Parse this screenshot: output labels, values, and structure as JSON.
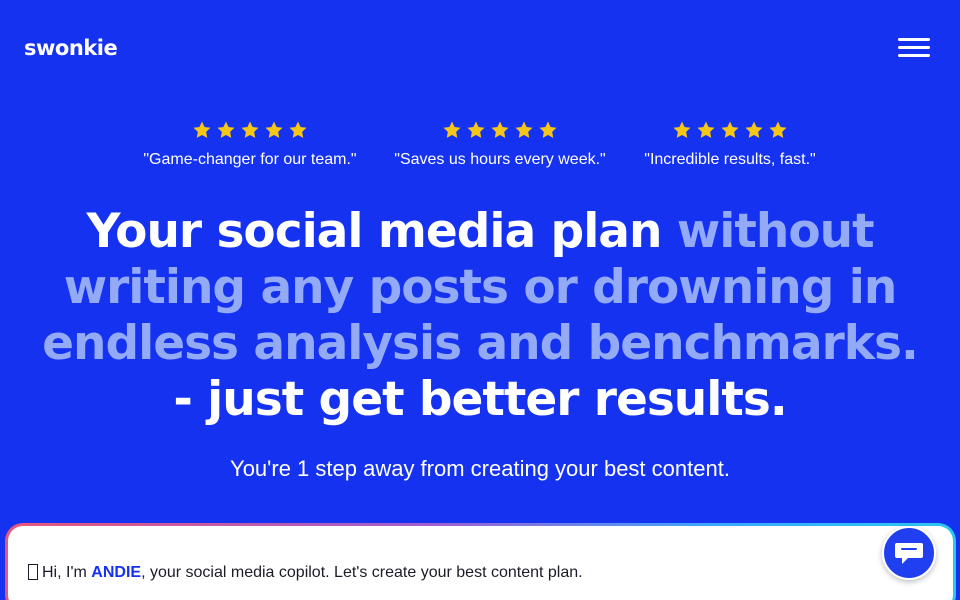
{
  "header": {
    "logo_text": "swonkie",
    "menu_icon": "hamburger-menu-icon"
  },
  "reviews": [
    {
      "rating": 5,
      "quote": "\"Game-changer for our team.\""
    },
    {
      "rating": 5,
      "quote": "\"Saves us hours every week.\""
    },
    {
      "rating": 5,
      "quote": "\"Incredible results, fast.\""
    }
  ],
  "hero": {
    "headline_part1": "Your social media plan ",
    "headline_part2": "without writing any posts or drowning in endless analysis and benchmarks.",
    "headline_part3": "- just get better results.",
    "subheadline": "You're 1 step away from creating your best content."
  },
  "chat": {
    "intro_prefix": "Hi, I'm ",
    "assistant_name": "ANDIE",
    "intro_suffix": ", your social media copilot. Let's create your best content plan.",
    "launcher_icon": "chat-bubble-icon"
  },
  "colors": {
    "background": "#1432f0",
    "headline_highlight": "#93aaf7",
    "star": "#f5c518",
    "accent": "#1432f0"
  }
}
